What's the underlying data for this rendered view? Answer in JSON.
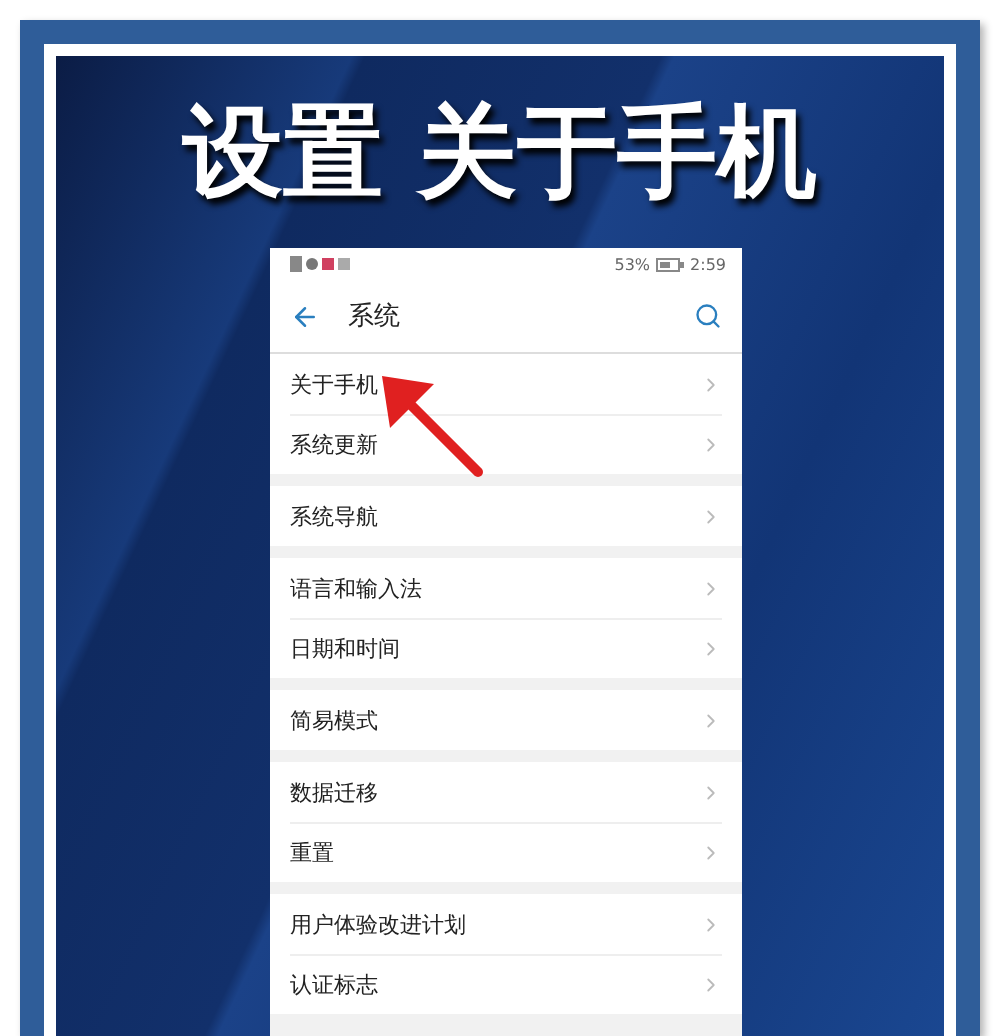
{
  "banner": {
    "title": "设置 关于手机"
  },
  "status_bar": {
    "battery": "53%",
    "time": "2:59"
  },
  "header": {
    "title": "系统"
  },
  "groups": [
    {
      "items": [
        {
          "label": "关于手机",
          "pointed": true
        },
        {
          "label": "系统更新",
          "pointed": false
        }
      ]
    },
    {
      "items": [
        {
          "label": "系统导航",
          "pointed": false
        }
      ]
    },
    {
      "items": [
        {
          "label": "语言和输入法",
          "pointed": false
        },
        {
          "label": "日期和时间",
          "pointed": false
        }
      ]
    },
    {
      "items": [
        {
          "label": "简易模式",
          "pointed": false
        }
      ]
    },
    {
      "items": [
        {
          "label": "数据迁移",
          "pointed": false
        },
        {
          "label": "重置",
          "pointed": false
        }
      ]
    },
    {
      "items": [
        {
          "label": "用户体验改进计划",
          "pointed": false
        },
        {
          "label": "认证标志",
          "pointed": false
        }
      ]
    }
  ]
}
